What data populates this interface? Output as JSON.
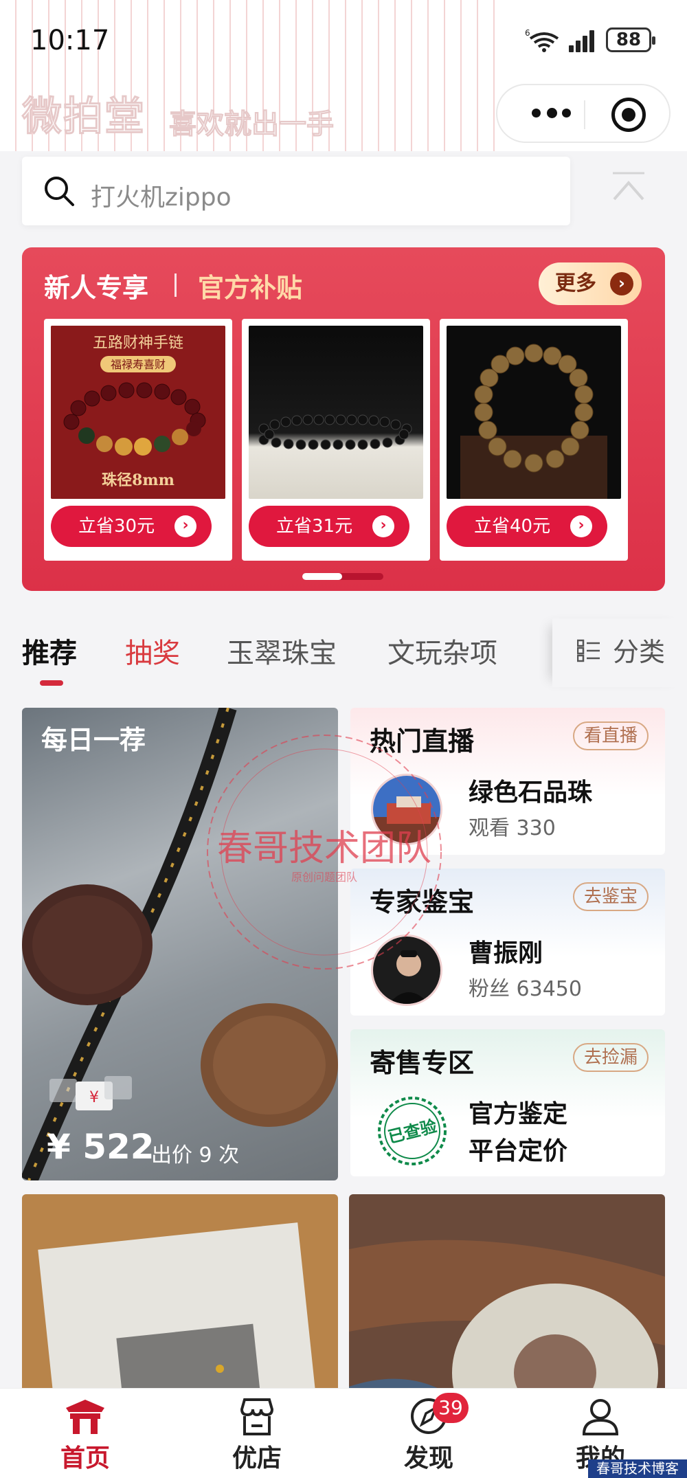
{
  "status_bar": {
    "time": "10:17",
    "battery": "88",
    "wifi_tag": "6"
  },
  "header": {
    "brand": "微拍堂",
    "slogan": "喜欢就出一手"
  },
  "search": {
    "placeholder": "打火机zippo"
  },
  "promo": {
    "title_left": "新人专享",
    "title_right": "官方补贴",
    "more_label": "更多",
    "cards": [
      {
        "save_label": "立省30元",
        "image_text_top": "五路财神手链",
        "image_text_sub": "福禄寿喜财",
        "image_text_bottom": "珠径8mm"
      },
      {
        "save_label": "立省31元"
      },
      {
        "save_label": "立省40元"
      }
    ]
  },
  "tabs": {
    "items": [
      "推荐",
      "抽奖",
      "玉翠珠宝",
      "文玩杂项"
    ],
    "category_label": "分类"
  },
  "daily_pick": {
    "title": "每日一荐",
    "price": "¥ 522",
    "bids": "出价 9 次"
  },
  "live": {
    "heading": "热门直播",
    "action": "看直播",
    "name": "绿色石品珠",
    "meta": "观看 330"
  },
  "expert": {
    "heading": "专家鉴宝",
    "action": "去鉴宝",
    "name": "曹振刚",
    "meta": "粉丝 63450"
  },
  "consign": {
    "heading": "寄售专区",
    "action": "去捡漏",
    "line1": "官方鉴定",
    "line2": "平台定价",
    "stamp": "已查验"
  },
  "watermark": {
    "text": "春哥技术团队",
    "sub": "原创问题团队"
  },
  "tabbar": {
    "home": "首页",
    "shop": "优店",
    "discover": "发现",
    "discover_badge": "39",
    "mine": "我的"
  },
  "corner_watermark": "春哥技术博客",
  "colors": {
    "accent": "#d42a3c",
    "promo": "#e04055",
    "gold": "#ffd9a8"
  }
}
